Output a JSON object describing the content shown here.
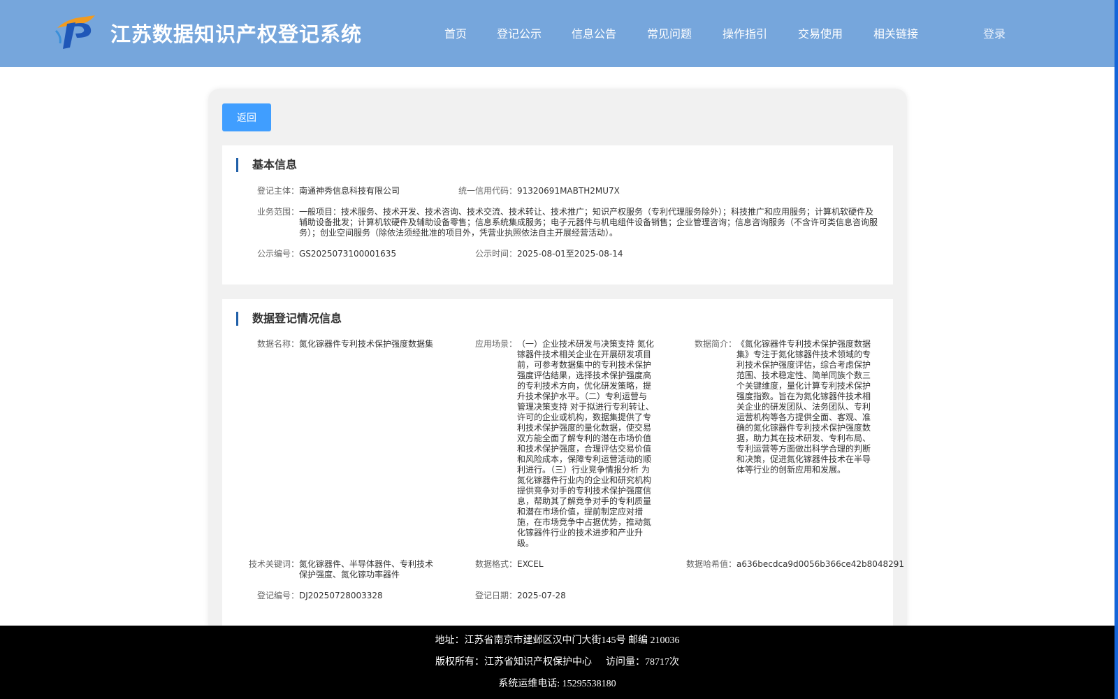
{
  "header": {
    "system_title": "江苏数据知识产权登记系统",
    "nav": [
      "首页",
      "登记公示",
      "信息公告",
      "常见问题",
      "操作指引",
      "交易使用",
      "相关链接"
    ],
    "login_label": "登录"
  },
  "back_label": "返回",
  "basic_info": {
    "title": "基本信息",
    "subject_label": "登记主体：",
    "subject": "南通神秀信息科技有限公司",
    "credit_code_label": "统一信用代码：",
    "credit_code": "91320691MABTH2MU7X",
    "business_scope_label": "业务范围：",
    "business_scope": "一般项目：技术服务、技术开发、技术咨询、技术交流、技术转让、技术推广；知识产权服务（专利代理服务除外）；科技推广和应用服务；计算机软硬件及辅助设备批发；计算机软硬件及辅助设备零售；信息系统集成服务；电子元器件与机电组件设备销售；企业管理咨询；信息咨询服务（不含许可类信息咨询服务）；创业空间服务（除依法须经批准的项目外，凭营业执照依法自主开展经营活动）。",
    "notice_no_label": "公示编号：",
    "notice_no": "GS2025073100001635",
    "notice_time_label": "公示时间：",
    "notice_time": "2025-08-01至2025-08-14"
  },
  "registration_info": {
    "title": "数据登记情况信息",
    "data_name_label": "数据名称：",
    "data_name": "氮化镓器件专利技术保护强度数据集",
    "scenario_label": "应用场景：",
    "scenario": "（一）企业技术研发与决策支持 氮化镓器件技术相关企业在开展研发项目前，可参考数据集中的专利技术保护强度评估结果，选择技术保护强度高的专利技术方向，优化研发策略，提升技术保护水平。（二）专利运营与管理决策支持 对于拟进行专利转让、许可的企业或机构，数据集提供了专利技术保护强度的量化数据，使交易双方能全面了解专利的潜在市场价值和技术保护强度，合理评估交易价值和风险成本，保障专利运营活动的顺利进行。（三）行业竞争情报分析 为氮化镓器件行业内的企业和研究机构提供竞争对手的专利技术保护强度信息，帮助其了解竞争对手的专利质量和潜在市场价值，提前制定应对措施，在市场竞争中占据优势，推动氮化镓器件行业的技术进步和产业升级。",
    "intro_label": "数据简介：",
    "intro": "《氮化镓器件专利技术保护强度数据集》专注于氮化镓器件技术领域的专利技术保护强度评估，综合考虑保护范围、技术稳定性、简单同族个数三个关键维度，量化计算专利技术保护强度指数。旨在为氮化镓器件技术相关企业的研发团队、法务团队、专利运营机构等各方提供全面、客观、准确的氮化镓器件专利技术保护强度数据，助力其在技术研发、专利布局、专利运营等方面做出科学合理的判断和决策，促进氮化镓器件技术在半导体等行业的创新应用和发展。",
    "keywords_label": "技术关键词：",
    "keywords": "氮化镓器件、半导体器件、专利技术保护强度、氮化镓功率器件",
    "format_label": "数据格式：",
    "format": "EXCEL",
    "hash_label": "数据哈希值：",
    "hash": "a636becdca9d0056b366ce42b8048291",
    "reg_no_label": "登记编号：",
    "reg_no": "DJ20250728003328",
    "reg_date_label": "登记日期：",
    "reg_date": "2025-07-28"
  },
  "footer": {
    "address": "地址：江苏省南京市建邺区汉中门大街145号 邮编 210036",
    "copyright": "版权所有：江苏省知识产权保护中心",
    "visits": "访问量：78717次",
    "phone": "系统运维电话: 15295538180"
  },
  "colors": {
    "header_bg": "#76a6dc",
    "button_bg": "#409eff",
    "section_accent": "#1f5fa8",
    "footer_bg": "#000000"
  }
}
